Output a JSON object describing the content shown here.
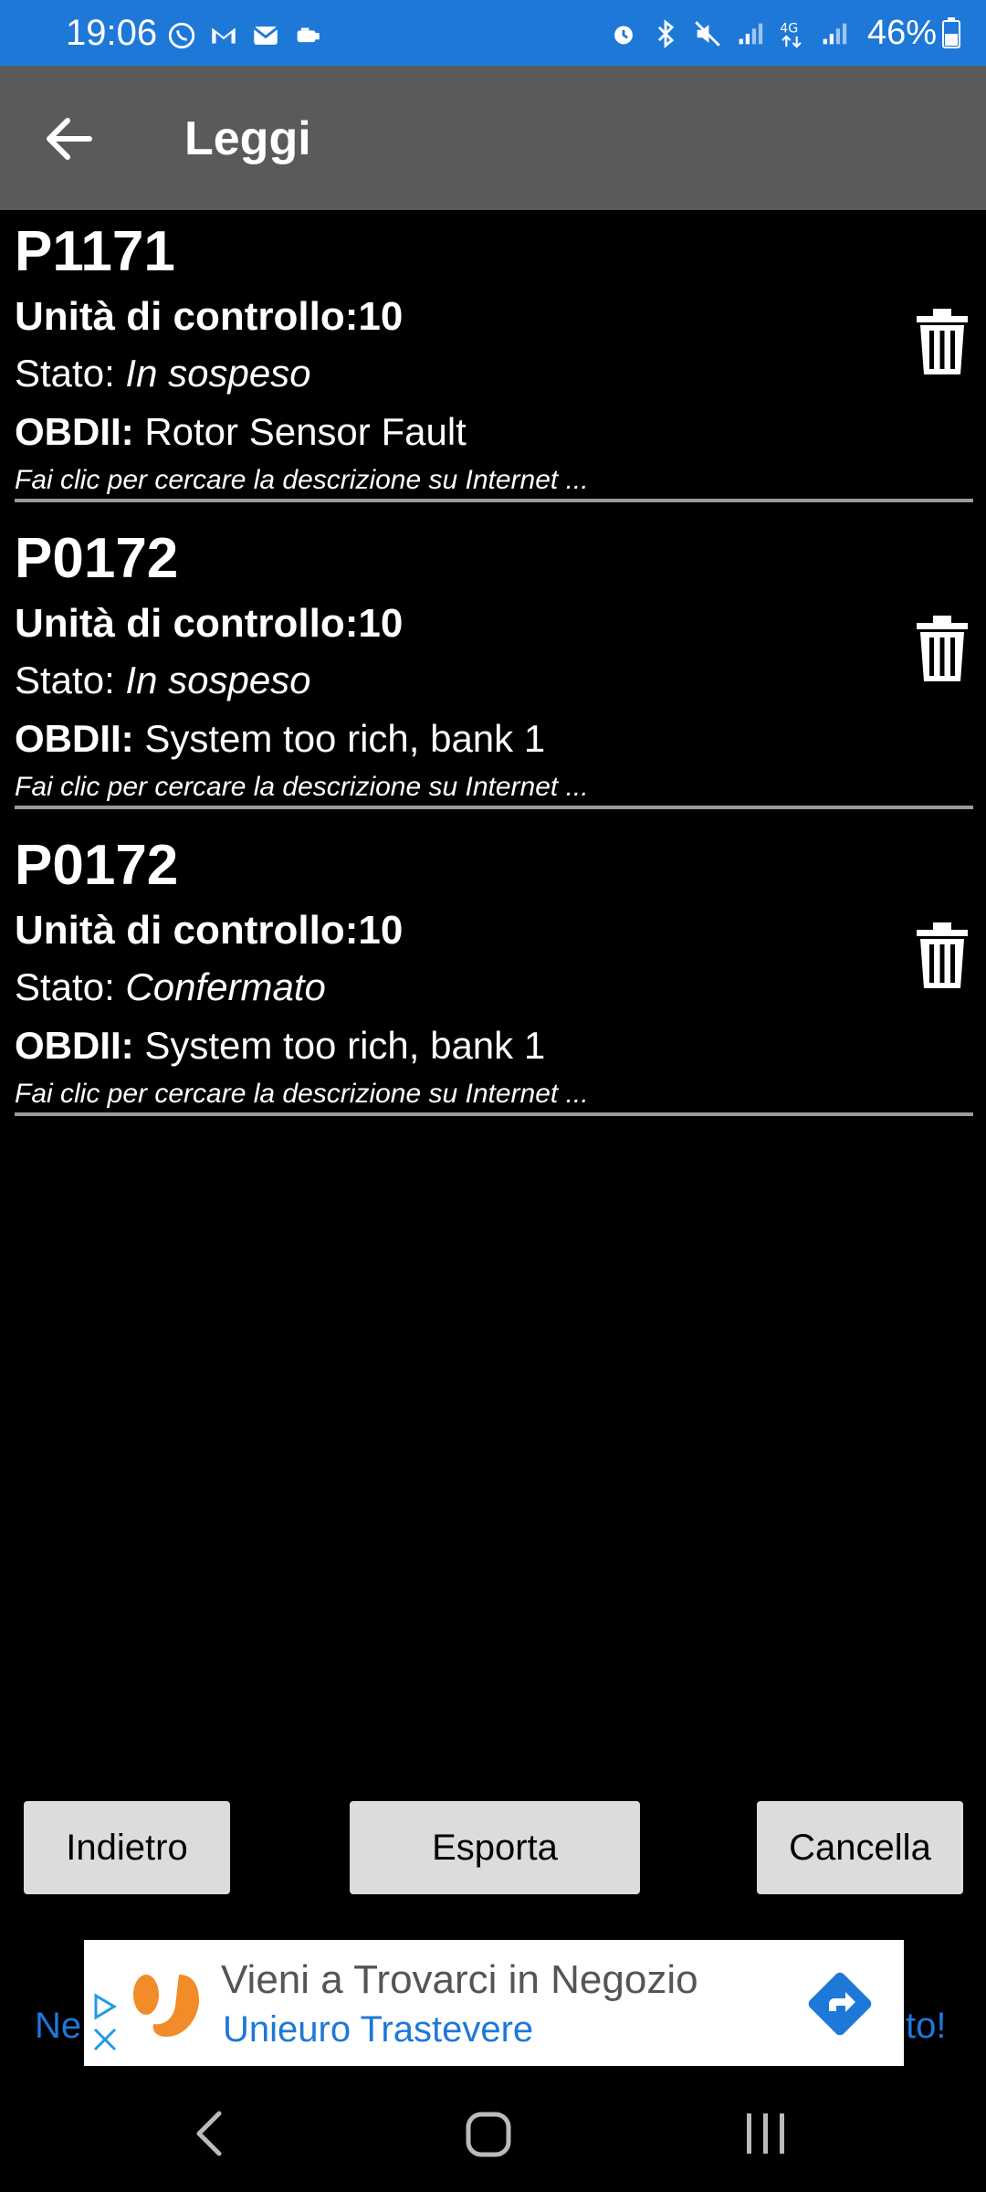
{
  "status_bar": {
    "time": "19:06",
    "battery": "46%",
    "network": "4G"
  },
  "app_bar": {
    "title": "Leggi"
  },
  "faults": [
    {
      "code": "P1171",
      "unit": "Unità di controllo:10",
      "status_label": "Stato: ",
      "status_value": "In sospeso",
      "obd_label": "OBDII:",
      "obd_value": " Rotor Sensor Fault",
      "hint": "Fai clic per cercare la descrizione su Internet ..."
    },
    {
      "code": "P0172",
      "unit": "Unità di controllo:10",
      "status_label": "Stato: ",
      "status_value": "In sospeso",
      "obd_label": "OBDII:",
      "obd_value": " System too rich, bank 1",
      "hint": "Fai clic per cercare la descrizione su Internet ..."
    },
    {
      "code": "P0172",
      "unit": "Unità di controllo:10",
      "status_label": "Stato: ",
      "status_value": "Confermato",
      "obd_label": "OBDII:",
      "obd_value": " System too rich, bank 1",
      "hint": "Fai clic per cercare la descrizione su Internet ..."
    }
  ],
  "buttons": {
    "back": "Indietro",
    "export": "Esporta",
    "cancel": "Cancella"
  },
  "ad": {
    "title": "Vieni a Trovarci in Negozio",
    "subtitle": "Unieuro Trastevere",
    "left_fragment": "Ne",
    "right_fragment": "to!"
  },
  "colors": {
    "status_bar": "#1E78D8",
    "app_bar": "#5a5a5a",
    "background": "#000000",
    "button": "#dcdcdc",
    "ad_accent": "#1E78D8",
    "ad_logo": "#F28C28"
  }
}
